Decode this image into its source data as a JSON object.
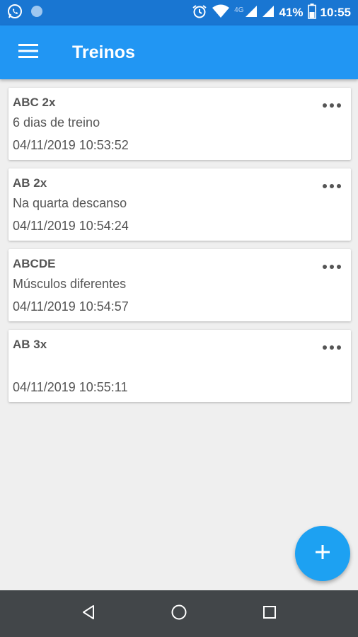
{
  "status_bar": {
    "battery": "41%",
    "time": "10:55",
    "network": "4G",
    "icons": [
      "whatsapp-icon",
      "circle-notification-icon",
      "alarm-icon",
      "wifi-icon",
      "signal-icon",
      "battery-icon"
    ]
  },
  "app_bar": {
    "title": "Treinos",
    "menu_icon": "hamburger-menu-icon"
  },
  "workouts": [
    {
      "title": "ABC 2x",
      "description": "6 dias de treino",
      "date": "04/11/2019 10:53:52"
    },
    {
      "title": "AB 2x",
      "description": "Na quarta descanso",
      "date": "04/11/2019 10:54:24"
    },
    {
      "title": "ABCDE",
      "description": "Músculos diferentes",
      "date": "04/11/2019 10:54:57"
    },
    {
      "title": "AB 3x",
      "description": "",
      "date": "04/11/2019 10:55:11"
    }
  ],
  "fab": {
    "icon": "plus-icon"
  },
  "nav_bar": {
    "icons": [
      "back-icon",
      "home-icon",
      "recents-icon"
    ]
  },
  "colors": {
    "status_bar": "#1976d2",
    "app_bar": "#2196f3",
    "fab": "#1da1f2",
    "background": "#efefef",
    "nav_bar": "#424649"
  }
}
